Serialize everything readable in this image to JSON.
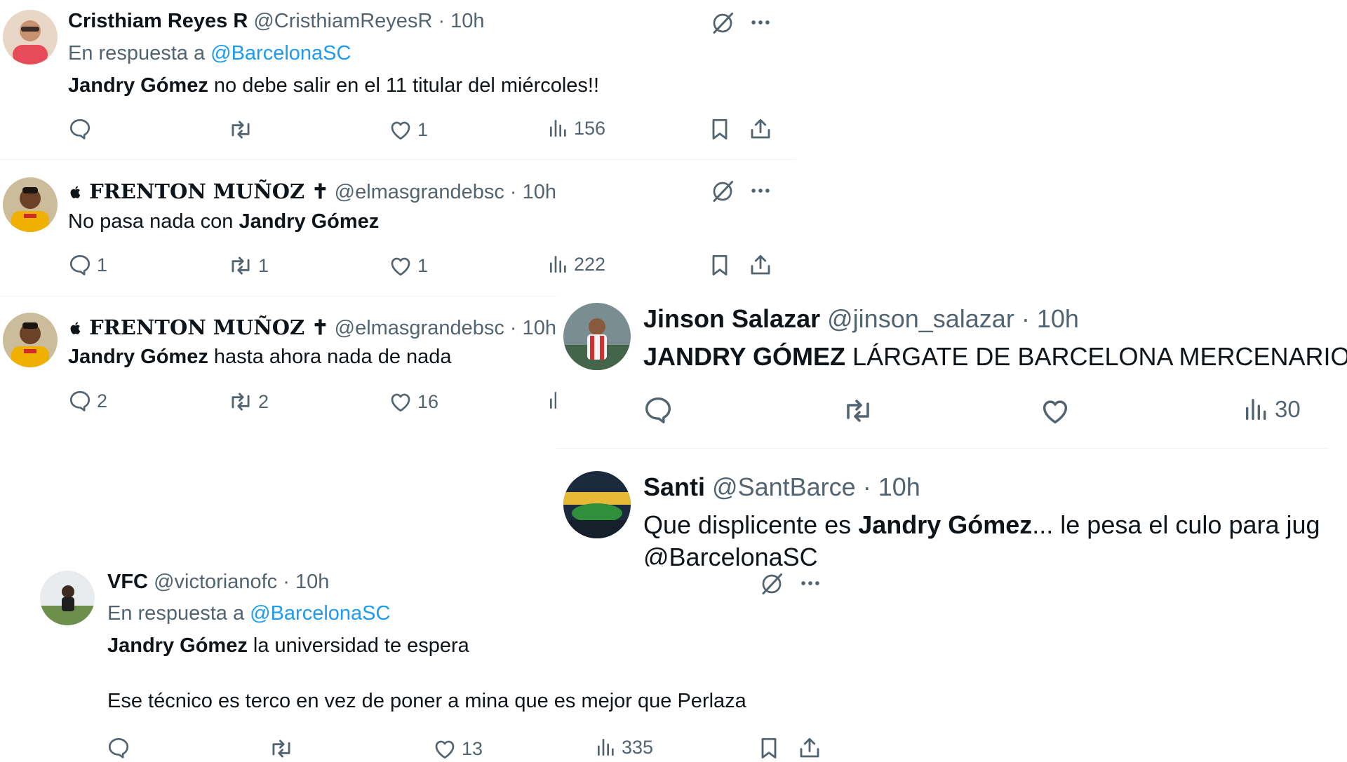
{
  "reply_prefix": "En respuesta a",
  "tweets": [
    {
      "name": "Cristhiam Reyes R",
      "handle": "@CristhiamReyesR",
      "time": "10h",
      "reply_to": "@BarcelonaSC",
      "text_bold": "Jandry Gómez",
      "text_rest": " no debe salir en el 11 titular del miércoles!!",
      "replies": "",
      "reposts": "",
      "likes": "1",
      "views": "156"
    },
    {
      "name_prefix": "",
      "name": "FRENTON MUÑOZ",
      "name_suffix": "✝",
      "handle": "@elmasgrandebsc",
      "time": "10h",
      "text_plain": "No pasa nada con ",
      "text_bold": "Jandry Gómez",
      "replies": "1",
      "reposts": "1",
      "likes": "1",
      "views": "222"
    },
    {
      "name_prefix": "",
      "name": "FRENTON MUÑOZ",
      "name_suffix": "✝",
      "handle": "@elmasgrandebsc",
      "time": "10h",
      "text_bold": "Jandry Gómez",
      "text_rest": " hasta ahora nada de nada",
      "replies": "2",
      "reposts": "2",
      "likes": "16"
    },
    {
      "name": "Jinson Salazar",
      "handle": "@jinson_salazar",
      "time": "10h",
      "text_bold": "JANDRY GÓMEZ",
      "text_rest": " LÁRGATE DE BARCELONA MERCENARIO",
      "views": "30"
    },
    {
      "name": "Santi",
      "handle": "@SantBarce",
      "time": "10h",
      "text_plain": "Que displicente es ",
      "text_bold": "Jandry Gómez",
      "text_rest": "... le pesa el culo para jug",
      "mention": "@BarcelonaSC"
    },
    {
      "name": "VFC",
      "handle": "@victorianofc",
      "time": "10h",
      "reply_to": "@BarcelonaSC",
      "text_bold": "Jandry Gómez",
      "text_rest": " la universidad te espera",
      "text_line2": "Ese técnico es terco en vez de poner a mina que es mejor que Perlaza",
      "replies": "",
      "reposts": "",
      "likes": "13",
      "views": "335"
    }
  ],
  "icons": [
    "reply-icon",
    "repost-icon",
    "like-icon",
    "views-icon",
    "bookmark-icon",
    "share-icon",
    "grok-icon",
    "more-icon"
  ]
}
